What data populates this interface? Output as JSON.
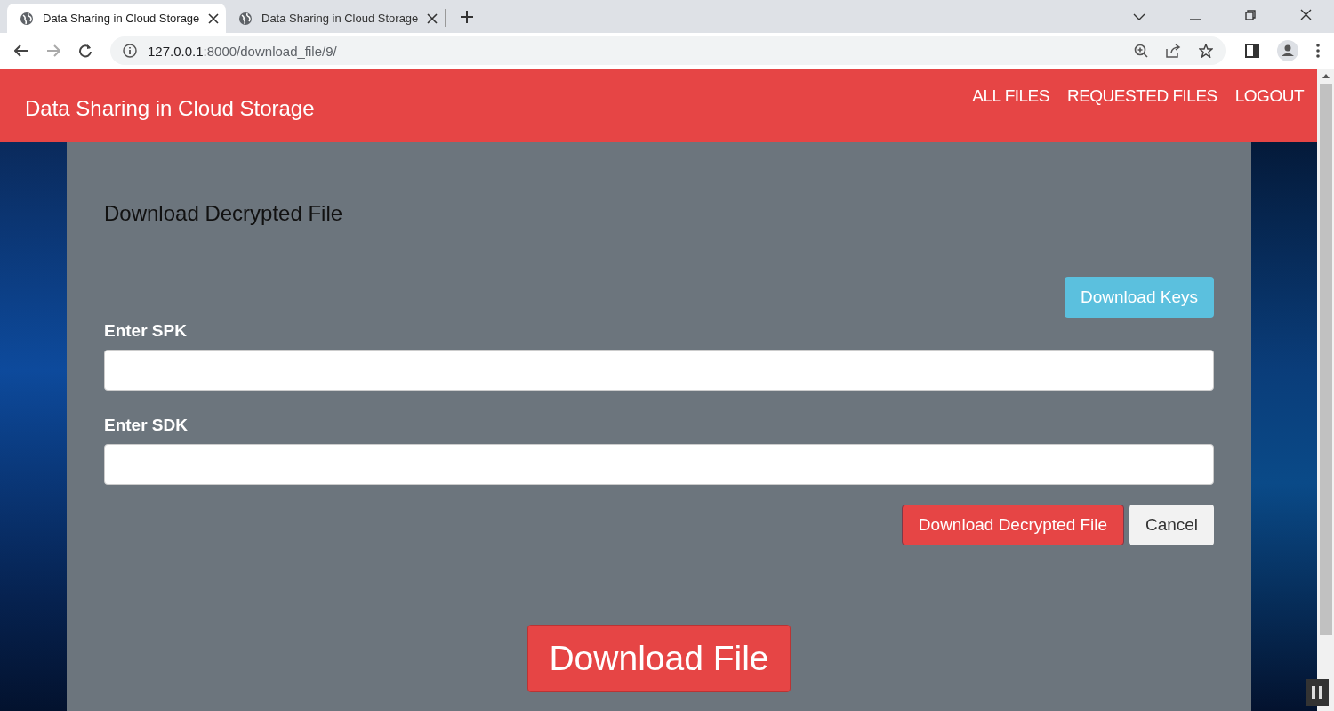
{
  "browser": {
    "tabs": [
      {
        "title": "Data Sharing in Cloud Storage",
        "selected": true
      },
      {
        "title": "Data Sharing in Cloud Storage",
        "selected": false
      }
    ],
    "url": {
      "host": "127.0.0.1",
      "path": ":8000/download_file/9/"
    }
  },
  "navbar": {
    "brand": "Data Sharing in Cloud Storage",
    "links": [
      "ALL FILES",
      "REQUESTED FILES",
      "LOGOUT"
    ]
  },
  "form": {
    "title": "Download Decrypted File",
    "keys_button": "Download Keys",
    "fields": [
      {
        "label": "Enter SPK"
      },
      {
        "label": "Enter SDK"
      }
    ],
    "submit_button": "Download Decrypted File",
    "cancel_button": "Cancel"
  },
  "download_button": "Download File"
}
